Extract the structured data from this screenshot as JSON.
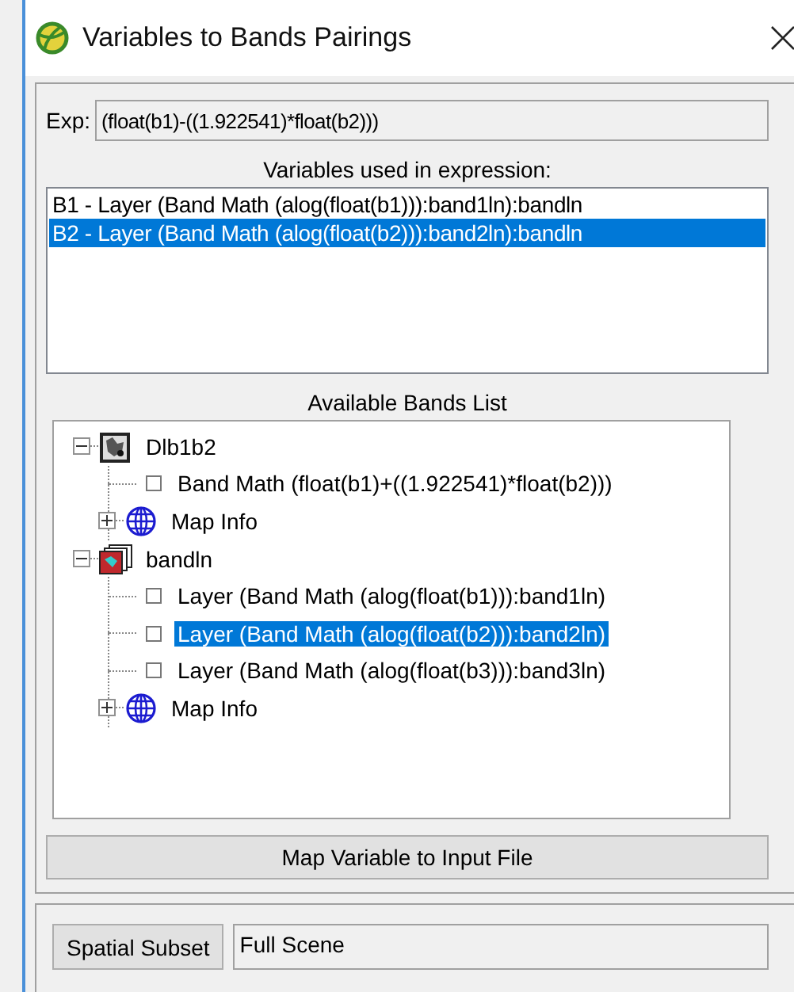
{
  "window": {
    "title": "Variables to Bands Pairings"
  },
  "expression": {
    "label": "Exp:",
    "value": "(float(b1)-((1.922541)*float(b2)))"
  },
  "variables": {
    "heading": "Variables used in expression:",
    "items": [
      {
        "label": "B1 - Layer (Band Math (alog(float(b1))):band1ln):bandln",
        "selected": false
      },
      {
        "label": "B2 - Layer (Band Math (alog(float(b2))):band2ln):bandln",
        "selected": true
      }
    ]
  },
  "bands": {
    "heading": "Available Bands List",
    "tree": [
      {
        "kind": "image",
        "label": "Dlb1b2",
        "expanded": true,
        "selected": false,
        "children": [
          {
            "kind": "band",
            "label": "Band Math (float(b1)+((1.922541)*float(b2)))",
            "selected": false
          },
          {
            "kind": "mapinfo",
            "label": "Map Info",
            "expanded": false,
            "selected": false
          }
        ]
      },
      {
        "kind": "stack",
        "label": "bandln",
        "expanded": true,
        "selected": false,
        "children": [
          {
            "kind": "band",
            "label": "Layer (Band Math (alog(float(b1))):band1ln)",
            "selected": false
          },
          {
            "kind": "band",
            "label": "Layer (Band Math (alog(float(b2))):band2ln)",
            "selected": true
          },
          {
            "kind": "band",
            "label": "Layer (Band Math (alog(float(b3))):band3ln)",
            "selected": false
          },
          {
            "kind": "mapinfo",
            "label": "Map Info",
            "expanded": false,
            "selected": false
          }
        ]
      }
    ]
  },
  "map_button": "Map Variable to Input File",
  "subset": {
    "button": "Spatial Subset",
    "value": "Full Scene"
  }
}
